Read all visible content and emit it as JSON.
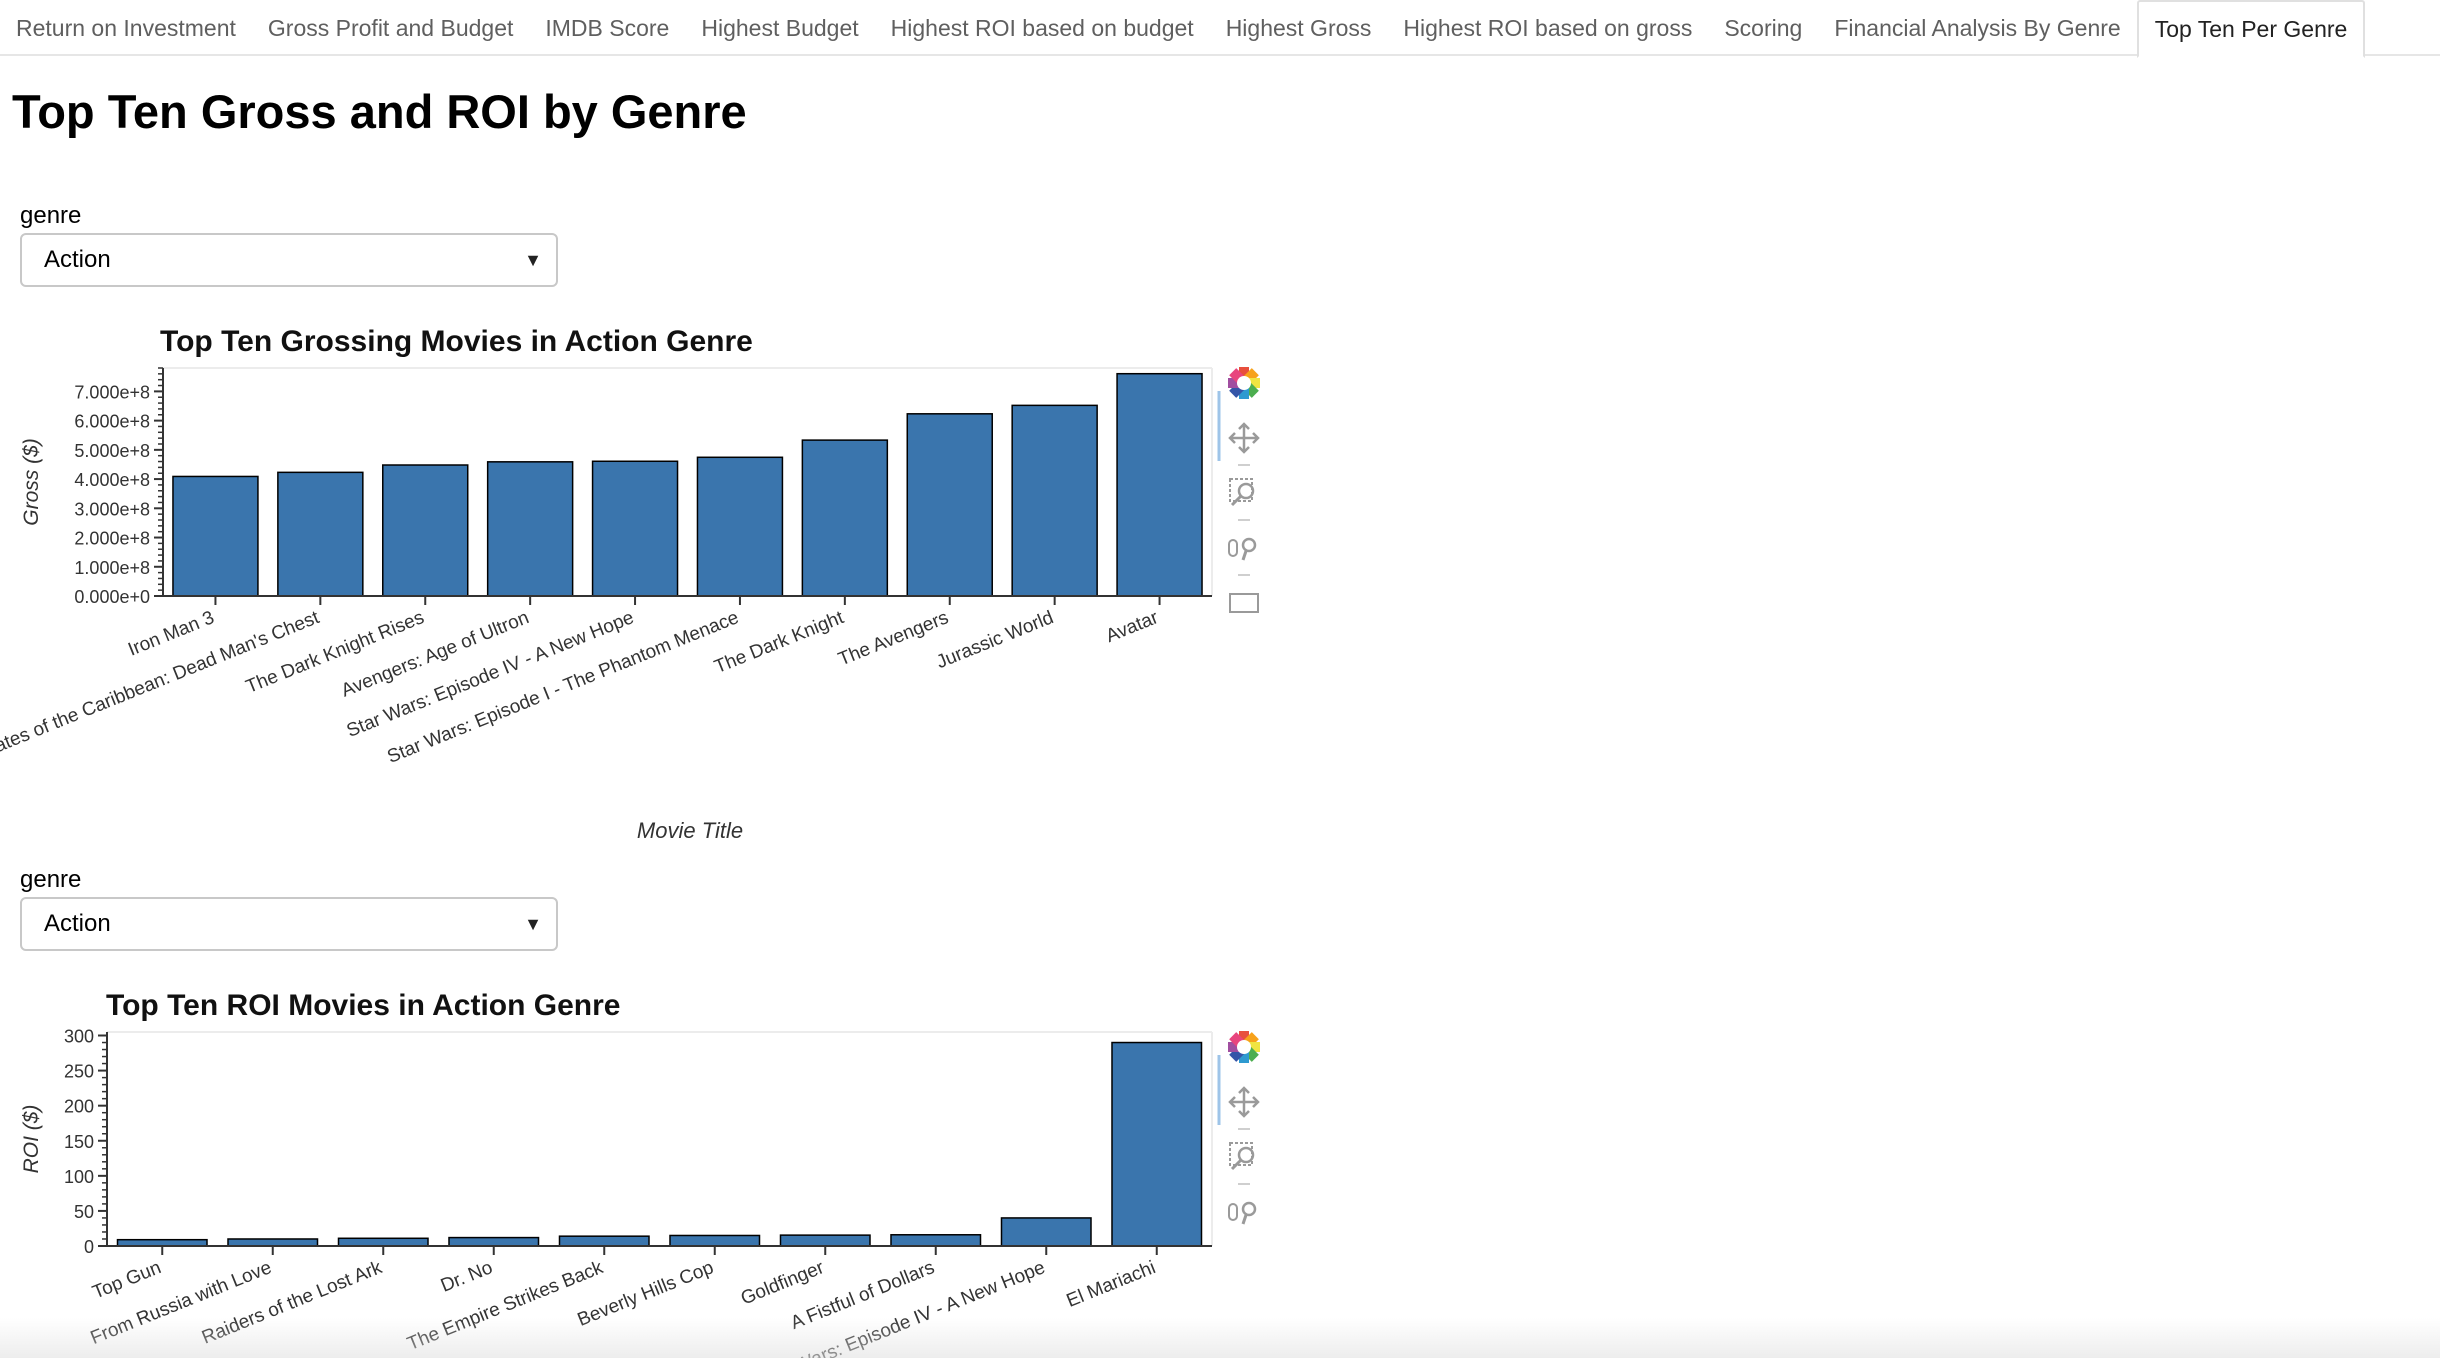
{
  "tabs": [
    {
      "label": "Return on Investment",
      "active": false
    },
    {
      "label": "Gross Profit and Budget",
      "active": false
    },
    {
      "label": "IMDB Score",
      "active": false
    },
    {
      "label": "Highest Budget",
      "active": false
    },
    {
      "label": "Highest ROI based on budget",
      "active": false
    },
    {
      "label": "Highest Gross",
      "active": false
    },
    {
      "label": "Highest ROI based on gross",
      "active": false
    },
    {
      "label": "Scoring",
      "active": false
    },
    {
      "label": "Financial Analysis By Genre",
      "active": false
    },
    {
      "label": "Top Ten Per Genre",
      "active": true
    }
  ],
  "page": {
    "title": "Top Ten Gross and ROI by Genre"
  },
  "selectors": [
    {
      "label": "genre",
      "value": "Action"
    },
    {
      "label": "genre",
      "value": "Action"
    }
  ],
  "toolbar_icons": [
    "bokeh-logo-icon",
    "pan-icon",
    "box-zoom-icon",
    "wheel-zoom-icon",
    "save-icon"
  ],
  "colors": {
    "bar": "#3a75ad",
    "bar_stroke": "#000000",
    "accent_tab_border": "#e0e0e0"
  },
  "chart_data": [
    {
      "type": "bar",
      "title": "Top Ten Grossing Movies in Action Genre",
      "xlabel": "Movie Title",
      "ylabel": "Gross ($)",
      "ylim": [
        0,
        780000000
      ],
      "yticks": [
        "0.000e+0",
        "1.000e+8",
        "2.000e+8",
        "3.000e+8",
        "4.000e+8",
        "5.000e+8",
        "6.000e+8",
        "7.000e+8"
      ],
      "categories": [
        "Iron Man 3",
        "Pirates of the Caribbean: Dead Man's Chest",
        "The Dark Knight Rises",
        "Avengers: Age of Ultron",
        "Star Wars: Episode IV - A New Hope",
        "Star Wars: Episode I - The Phantom Menace",
        "The Dark Knight",
        "The Avengers",
        "Jurassic World",
        "Avatar"
      ],
      "values": [
        408992272,
        423032628,
        448130642,
        458991599,
        460935665,
        474544677,
        533316061,
        623279547,
        652177271,
        760505847
      ],
      "grid": false,
      "legend": "none"
    },
    {
      "type": "bar",
      "title": "Top Ten ROI Movies in Action Genre",
      "xlabel": "",
      "ylabel": "ROI ($)",
      "ylim": [
        0,
        305
      ],
      "yticks": [
        "0",
        "50",
        "100",
        "150",
        "200",
        "250",
        "300"
      ],
      "categories": [
        "Top Gun",
        "From Russia with Love",
        "Raiders of the Lost Ark",
        "Dr. No",
        "The Empire Strikes Back",
        "Beverly Hills Cop",
        "Goldfinger",
        "A Fistful of Dollars",
        "Star Wars: Episode IV - A New Hope",
        "El Mariachi"
      ],
      "values": [
        9,
        10,
        11,
        12,
        14,
        15,
        15.5,
        16,
        40,
        290
      ],
      "grid": false,
      "legend": "none"
    }
  ]
}
